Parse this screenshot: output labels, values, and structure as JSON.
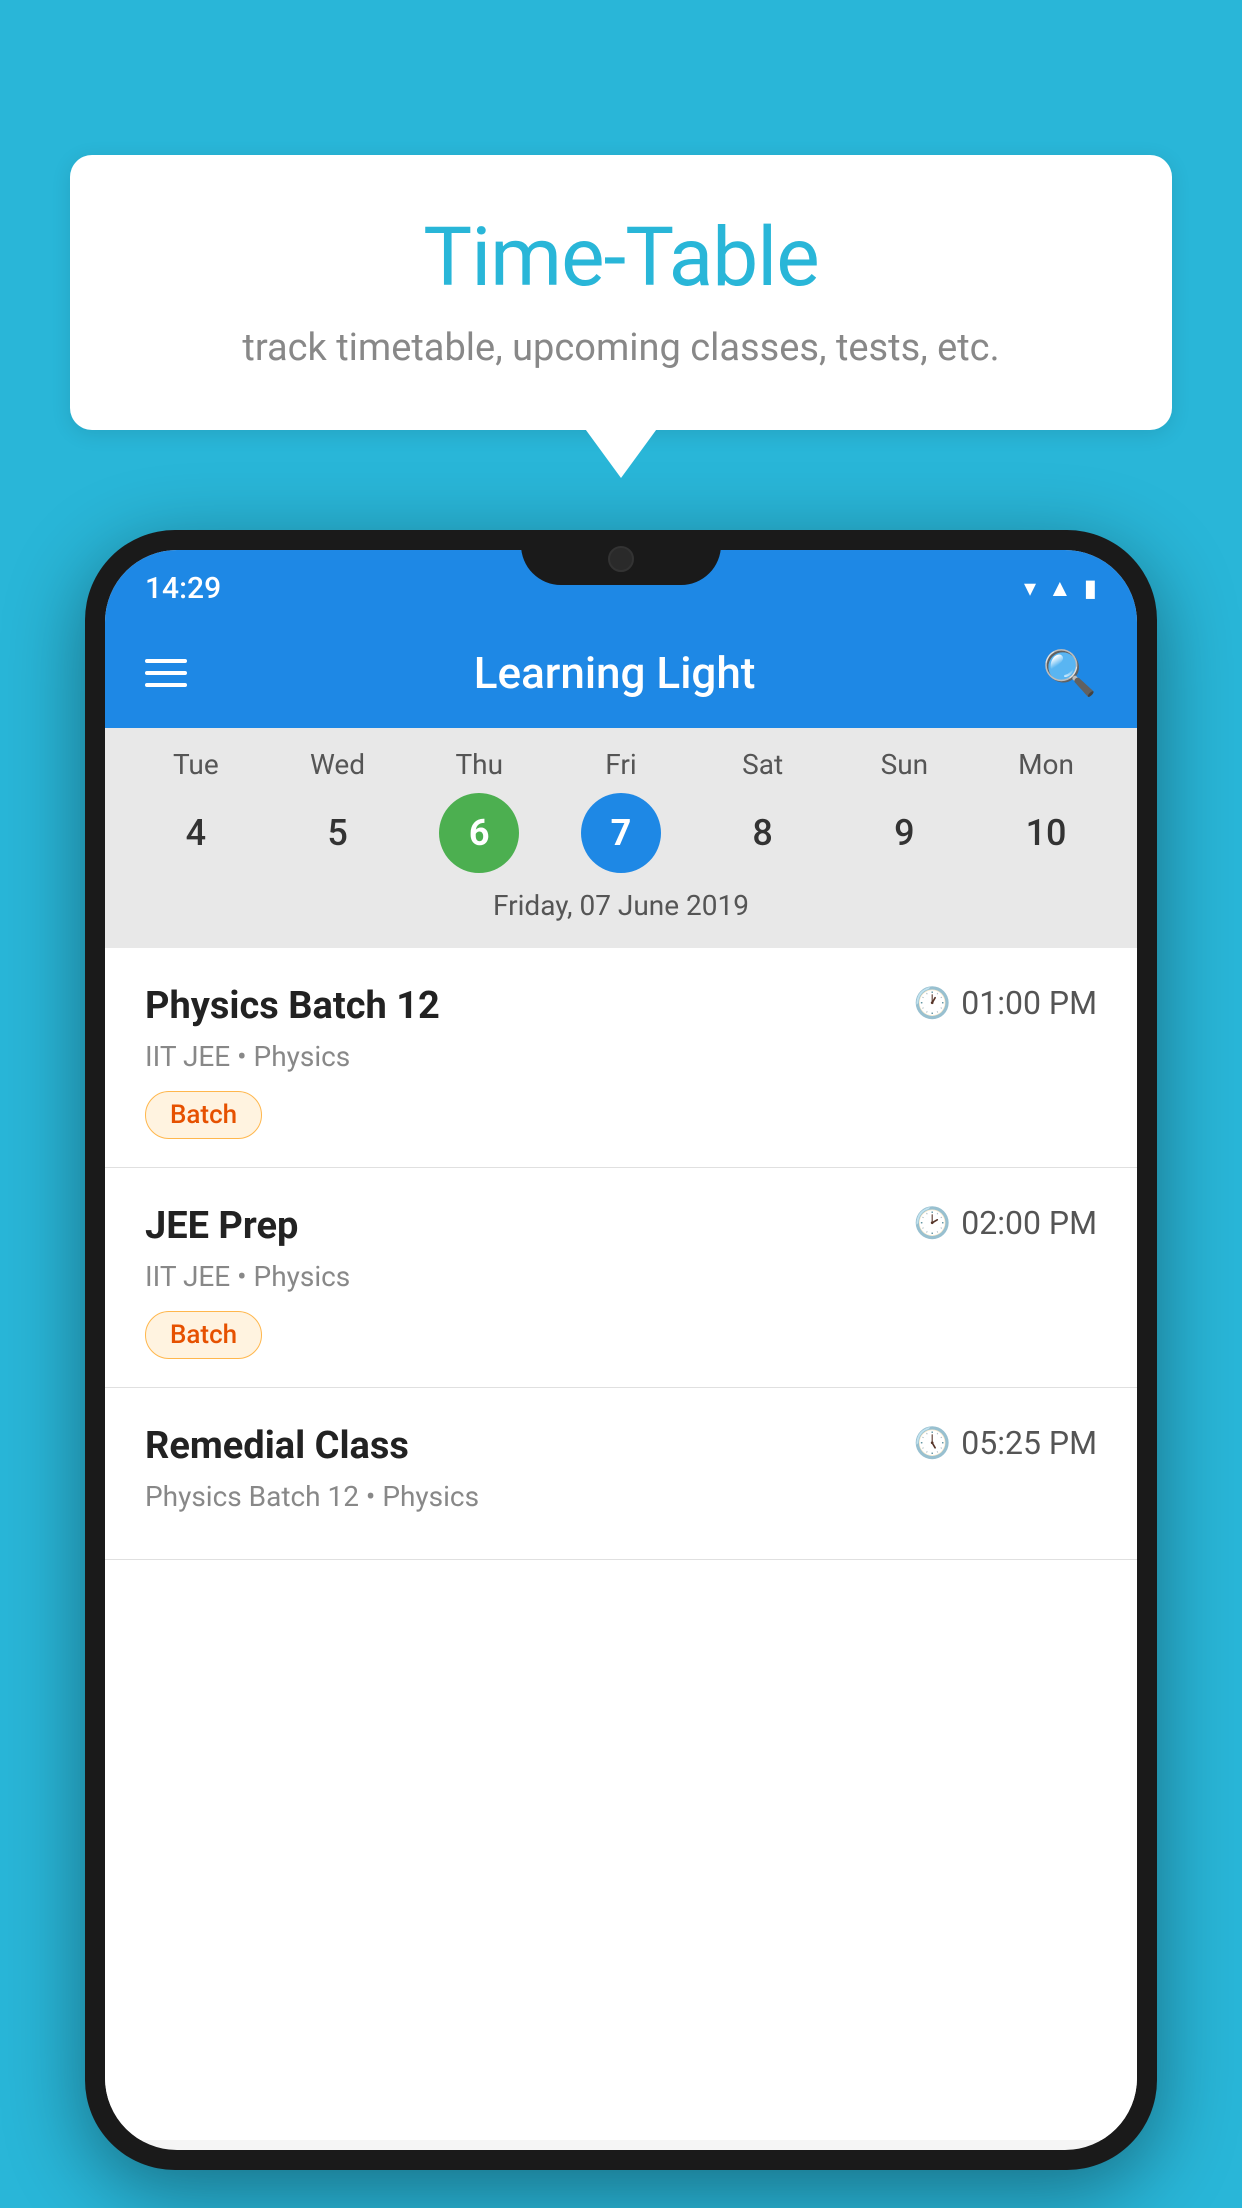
{
  "background_color": "#29B6D8",
  "bubble": {
    "title": "Time-Table",
    "subtitle": "track timetable, upcoming classes, tests, etc."
  },
  "phone": {
    "status_bar": {
      "time": "14:29"
    },
    "app_bar": {
      "title": "Learning Light"
    },
    "calendar": {
      "days": [
        "Tue",
        "Wed",
        "Thu",
        "Fri",
        "Sat",
        "Sun",
        "Mon"
      ],
      "dates": [
        "4",
        "5",
        "6",
        "7",
        "8",
        "9",
        "10"
      ],
      "today_index": 2,
      "selected_index": 3,
      "selected_date_label": "Friday, 07 June 2019"
    },
    "schedule": [
      {
        "title": "Physics Batch 12",
        "time": "01:00 PM",
        "subject": "IIT JEE • Physics",
        "badge": "Batch"
      },
      {
        "title": "JEE Prep",
        "time": "02:00 PM",
        "subject": "IIT JEE • Physics",
        "badge": "Batch"
      },
      {
        "title": "Remedial Class",
        "time": "05:25 PM",
        "subject": "Physics Batch 12 • Physics",
        "badge": null
      }
    ]
  }
}
